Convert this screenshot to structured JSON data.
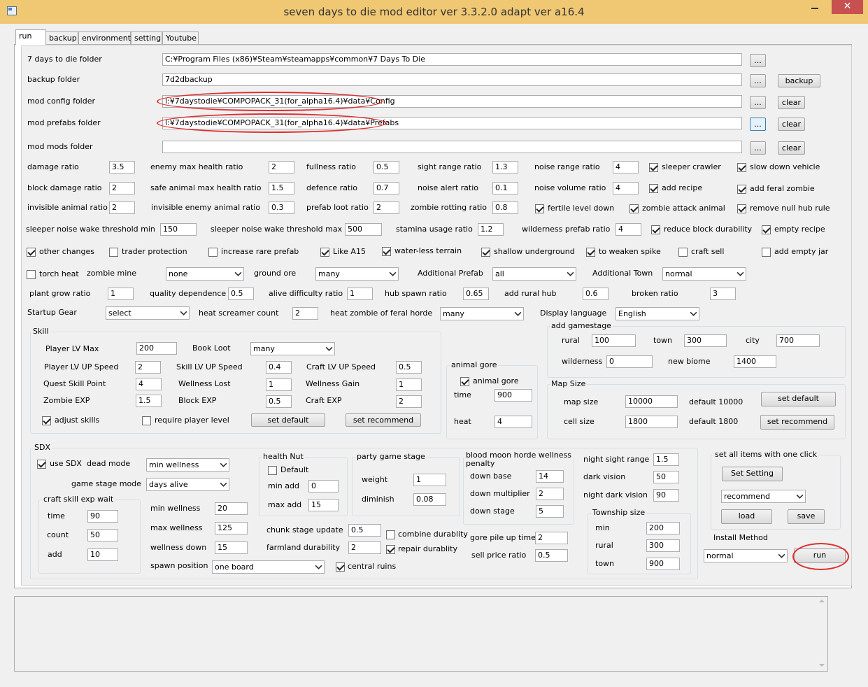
{
  "title": "seven days to die mod editor ver 3.3.2.0 adapt ver a16.4",
  "tabs": [
    "run",
    "backup",
    "environment",
    "setting",
    "Youtube"
  ],
  "folders": {
    "sdtd_label": "7 days to die folder",
    "sdtd_value": "C:¥Program Files (x86)¥Steam¥steamapps¥common¥7 Days To Die",
    "backup_label": "backup folder",
    "backup_value": "7d2dbackup",
    "config_label": "mod config folder",
    "config_value": "l:¥7daystodie¥COMPOPACK_31(for_alpha16.4)¥data¥Config",
    "prefabs_label": "mod prefabs folder",
    "prefabs_value": "l:¥7daystodie¥COMPOPACK_31(for_alpha16.4)¥data¥Prefabs",
    "mods_label": "mod mods folder",
    "mods_value": "",
    "browse": "...",
    "backup_btn": "backup",
    "clear_btn": "clear"
  },
  "r1": {
    "damage_ratio": "damage ratio",
    "damage_ratio_v": "3.5",
    "enemy_max_health": "enemy max health ratio",
    "enemy_max_health_v": "2",
    "fullness": "fullness ratio",
    "fullness_v": "0.5",
    "sight_range": "sight range ratio",
    "sight_range_v": "1.3",
    "noise_range": "noise range ratio",
    "noise_range_v": "4",
    "sleeper_crawler": "sleeper crawler",
    "slow_down_vehicle": "slow down vehicle"
  },
  "r2": {
    "block_damage": "block damage ratio",
    "block_damage_v": "2",
    "safe_animal": "safe animal max health ratio",
    "safe_animal_v": "1.5",
    "defence": "defence ratio",
    "defence_v": "0.7",
    "noise_alert": "noise alert ratio",
    "noise_alert_v": "0.1",
    "noise_volume": "noise volume ratio",
    "noise_volume_v": "4",
    "add_recipe": "add recipe",
    "add_feral": "add feral zombie"
  },
  "r3": {
    "invisible_animal": "invisible animal ratio",
    "invisible_animal_v": "2",
    "invisible_enemy": "invisible enemy animal ratio",
    "invisible_enemy_v": "0.3",
    "prefab_loot": "prefab loot ratio",
    "prefab_loot_v": "2",
    "zombie_rotting": "zombie rotting ratio",
    "zombie_rotting_v": "0.8",
    "fertile": "fertile level down",
    "zombie_attack": "zombie attack animal",
    "remove_null": "remove null hub rule"
  },
  "r4": {
    "sleeper_min": "sleeper noise wake threshold min",
    "sleeper_min_v": "150",
    "sleeper_max": "sleeper noise wake threshold max",
    "sleeper_max_v": "500",
    "stamina": "stamina usage ratio",
    "stamina_v": "1.2",
    "wilderness": "wilderness prefab ratio",
    "wilderness_v": "4",
    "reduce_block": "reduce block durability",
    "empty_recipe": "empty recipe"
  },
  "r5": {
    "other": "other changes",
    "trader": "trader protection",
    "rare": "increase rare prefab",
    "likea15": "Like A15",
    "waterless": "water-less terrain",
    "shallow": "shallow underground",
    "weaken": "to weaken spike",
    "craftsell": "craft sell",
    "emptyjar": "add empty jar"
  },
  "r6": {
    "torch": "torch heat",
    "zmine": "zombie mine",
    "zmine_v": "none",
    "ground": "ground ore",
    "ground_v": "many",
    "addprefab": "Additional Prefab",
    "addprefab_v": "all",
    "addtown": "Additional Town",
    "addtown_v": "normal"
  },
  "r7": {
    "plant": "plant grow ratio",
    "plant_v": "1",
    "quality": "quality dependence",
    "quality_v": "0.5",
    "alive": "alive difficulty ratio",
    "alive_v": "1",
    "hub": "hub spawn ratio",
    "hub_v": "0.65",
    "rural": "add rural hub",
    "rural_v": "0.6",
    "broken": "broken ratio",
    "broken_v": "3"
  },
  "r8": {
    "startup": "Startup Gear",
    "startup_v": "select",
    "screamer": "heat screamer count",
    "screamer_v": "2",
    "feral": "heat zombie of feral horde",
    "feral_v": "many",
    "lang": "Display language",
    "lang_v": "English"
  },
  "skill": {
    "title": "Skill",
    "plv": "Player LV Max",
    "plv_v": "200",
    "book": "Book Loot",
    "book_v": "many",
    "plvup": "Player LV UP Speed",
    "plvup_v": "2",
    "slvup": "Skill LV UP Speed",
    "slvup_v": "0.4",
    "clvup": "Craft LV UP Speed",
    "clvup_v": "0.5",
    "quest": "Quest Skill Point",
    "quest_v": "4",
    "wlost": "Wellness Lost",
    "wlost_v": "1",
    "wgain": "Wellness Gain",
    "wgain_v": "1",
    "zexp": "Zombie EXP",
    "zexp_v": "1.5",
    "bexp": "Block EXP",
    "bexp_v": "0.5",
    "cexp": "Craft EXP",
    "cexp_v": "2",
    "adjust": "adjust skills",
    "reqlv": "require player level",
    "setdef": "set default",
    "setrec": "set recommend"
  },
  "gore": {
    "title": "animal gore",
    "cb": "animal gore",
    "time": "time",
    "time_v": "900",
    "heat": "heat",
    "heat_v": "4"
  },
  "gamestage": {
    "title": "add gamestage",
    "rural": "rural",
    "rural_v": "100",
    "town": "town",
    "town_v": "300",
    "city": "city",
    "city_v": "700",
    "wild": "wilderness",
    "wild_v": "0",
    "newb": "new biome",
    "newb_v": "1400"
  },
  "mapsize": {
    "title": "Map Size",
    "map": "map size",
    "map_v": "10000",
    "def1": "default 10000",
    "cell": "cell size",
    "cell_v": "1800",
    "def2": "default 1800",
    "setdef": "set default",
    "setrec": "set recommend"
  },
  "sdx": {
    "title": "SDX",
    "use": "use SDX",
    "dead": "dead mode",
    "dead_v": "min wellness",
    "gsmode": "game stage mode",
    "gsmode_v": "days alive",
    "cs_title": "craft skill exp wait",
    "time": "time",
    "time_v": "90",
    "count": "count",
    "count_v": "50",
    "add": "add",
    "add_v": "10",
    "minw": "min wellness",
    "minw_v": "20",
    "maxw": "max wellness",
    "maxw_v": "125",
    "wdown": "wellness down",
    "wdown_v": "15",
    "spawn": "spawn position",
    "spawn_v": "one board",
    "hn_title": "health Nut",
    "hn_default": "Default",
    "minadd": "min add",
    "minadd_v": "0",
    "maxadd": "max add",
    "maxadd_v": "15",
    "pg_title": "party game stage",
    "weight": "weight",
    "weight_v": "1",
    "dim": "diminish",
    "dim_v": "0.08",
    "chunk": "chunk stage update",
    "chunk_v": "0.5",
    "combine": "combine durablity",
    "farmland": "farmland durability",
    "farmland_v": "2",
    "repair": "repair durablity",
    "central": "central ruins",
    "bm_title1": "blood moon horde wellness",
    "bm_title2": "penalty",
    "dbase": "down base",
    "dbase_v": "14",
    "dmult": "down multiplier",
    "dmult_v": "2",
    "dstage": "down stage",
    "dstage_v": "5",
    "gore_pile": "gore pile up time",
    "gore_pile_v": "2",
    "sell": "sell price ratio",
    "sell_v": "0.5",
    "nsr": "night sight range",
    "nsr_v": "1.5",
    "dark": "dark vision",
    "dark_v": "50",
    "ndark": "night dark vision",
    "ndark_v": "90",
    "ts_title": "Township size",
    "tmin": "min",
    "tmin_v": "200",
    "trural": "rural",
    "trural_v": "300",
    "ttown": "town",
    "ttown_v": "900"
  },
  "setall": {
    "title": "set all items with one click",
    "setset": "Set Setting",
    "rec_v": "recommend",
    "load": "load",
    "save": "save",
    "install": "Install Method",
    "install_v": "normal",
    "run": "run"
  }
}
